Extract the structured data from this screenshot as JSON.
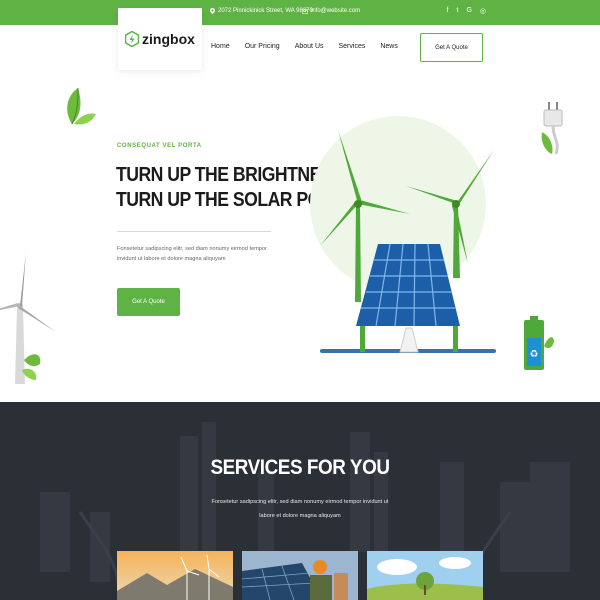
{
  "topbar": {
    "address": "2072 Pinnickinick Street, WA 98370",
    "email": "info@website.com",
    "social_icons": [
      "facebook-icon",
      "twitter-icon",
      "google-plus-icon",
      "instagram-icon"
    ],
    "social_glyphs": [
      "f",
      "t",
      "G",
      "◎"
    ]
  },
  "brand": {
    "name": "zingbox"
  },
  "nav": {
    "items": [
      "Home",
      "Our Pricing",
      "About Us",
      "Services",
      "News"
    ],
    "quote_label": "Get A Quote"
  },
  "hero": {
    "eyebrow": "CONSEQUAT VEL PORTA",
    "title_line1": "TURN UP THE BRIGHTNESS",
    "title_line2": "TURN UP THE SOLAR POWER.",
    "text": "Fonsetetur sadipscing elitr, sed diam nonumy eirmod tempor invidunt ut labore et dolore magna aliquyam",
    "button_label": "Get A Quote"
  },
  "services": {
    "title": "SERVICES FOR YOU",
    "text": "Fonsetetur sadipscing elitr, sed diam nonumy eirmod tempor invidunt ut labore et dolore magna aliquyam"
  },
  "colors": {
    "accent": "#5fb345",
    "dark": "#2b2f36",
    "text": "#1b1b1b"
  }
}
